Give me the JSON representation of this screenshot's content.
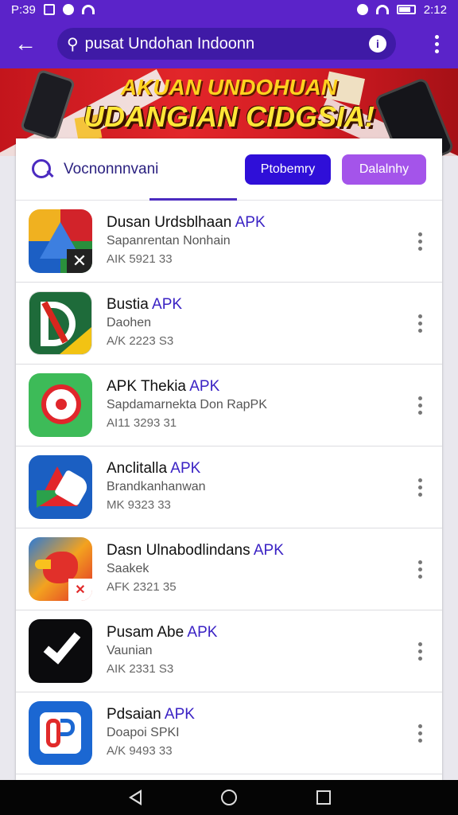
{
  "status_bar": {
    "left_time": "P:39",
    "right_time": "2:12"
  },
  "app_bar": {
    "back_label": "←",
    "search_text": "pusat Undohan Indoonn",
    "info_label": "i"
  },
  "banner": {
    "line1": "AKUAN UNDOHUAN",
    "line2": "UDANGIAN CIDGSIA!"
  },
  "card": {
    "search_label": "Vocnonnnvani",
    "chip_primary": "Ptobemry",
    "chip_secondary": "Dalalnhy",
    "items": [
      {
        "title": "Dusan Urdsblhaan",
        "tag": "APK",
        "subtitle": "Sapanrentan Nonhain",
        "meta": "AIK 5921 33"
      },
      {
        "title": "Bustia",
        "tag": "APK",
        "subtitle": "Daohen",
        "meta": "A/K 2223 S3"
      },
      {
        "title": "APK Thekia",
        "tag": "APK",
        "subtitle": "Sapdamarnekta Don RapPK",
        "meta": "AI11 3293 31"
      },
      {
        "title": "Anclitalla",
        "tag": "APK",
        "subtitle": "Brandkanhanwan",
        "meta": "MK 9323 33"
      },
      {
        "title": "Dasn Ulnabodlindans",
        "tag": "APK",
        "subtitle": "Saakek",
        "meta": "AFK 2321 35"
      },
      {
        "title": "Pusam Abe",
        "tag": "APK",
        "subtitle": "Vaunian",
        "meta": "AIK 2331 S3"
      },
      {
        "title": "Pdsaian",
        "tag": "APK",
        "subtitle": "Doapoi SPKI",
        "meta": "A/K 9493 33"
      }
    ]
  },
  "colors": {
    "brand_purple": "#5b23c9",
    "chip_primary": "#2f0fd8",
    "chip_secondary": "#a454ea",
    "apk_tag": "#3a22c4",
    "banner_red": "#d11b22"
  },
  "icons": [
    "search-icon",
    "back-arrow-icon",
    "overflow-menu-icon",
    "info-icon",
    "more-vert-icon"
  ]
}
